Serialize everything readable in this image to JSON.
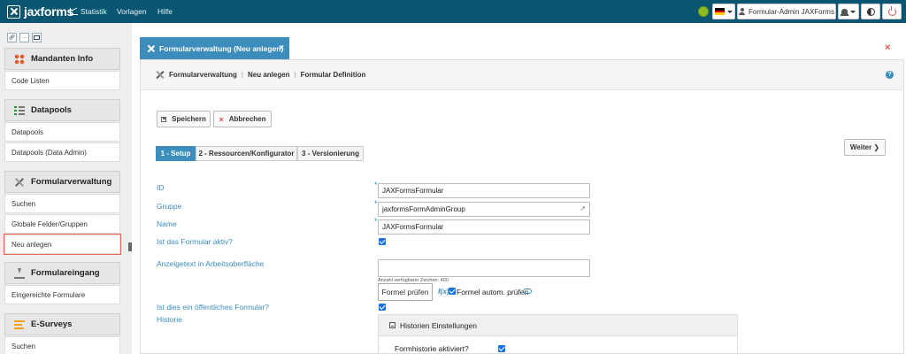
{
  "topbar": {
    "logo_text": "jaxforms",
    "nav": {
      "statistik": "Statistik",
      "vorlagen": "Vorlagen",
      "hilfe": "Hilfe"
    },
    "user_label": "Formular-Admin JAXForms",
    "colors": {
      "bar": "#0a5672",
      "status": "#8fbd1f"
    }
  },
  "sidebar": {
    "tools": [
      "link-icon",
      "ellipsis-icon",
      "folder-icon"
    ],
    "ellipsis": "···",
    "sections": {
      "mandanten": {
        "title": "Mandanten Info",
        "items": [
          "Code Listen"
        ]
      },
      "datapools": {
        "title": "Datapools",
        "items": [
          "Datapools",
          "Datapools (Data Admin)"
        ]
      },
      "formularverwaltung": {
        "title": "Formularverwaltung",
        "items": [
          "Suchen",
          "Globale Felder/Gruppen",
          "Neu anlegen"
        ]
      },
      "formulareingang": {
        "title": "Formulareingang",
        "items": [
          "Eingereichte Formulare"
        ]
      },
      "esurveys": {
        "title": "E-Surveys",
        "items": [
          "Suchen"
        ]
      }
    }
  },
  "tab": {
    "label": "Formularverwaltung (Neu anlegen)",
    "close": "×"
  },
  "close_main": "×",
  "breadcrumb": [
    "Formularverwaltung",
    "Neu anlegen",
    "Formular Definition"
  ],
  "breadcrumb_sep": "|",
  "help": "?",
  "actions": {
    "save": "Speichern",
    "cancel": "Abbrechen",
    "cancel_glyph": "×",
    "next": "Weiter ❯"
  },
  "wizard_tabs": [
    "1 - Setup",
    "2 - Ressourcen/Konfigurator",
    "3 - Versionierung"
  ],
  "form": {
    "required_mark": "*",
    "id": {
      "label": "ID",
      "value": "JAXFormsFormular"
    },
    "gruppe": {
      "label": "Gruppe",
      "value": "jaxformsFormAdminGroup",
      "icon_glyph": "↗"
    },
    "name": {
      "label": "Name",
      "value": "JAXFormsFormular"
    },
    "aktiv": {
      "label": "Ist das Formular aktiv?",
      "checked": true
    },
    "anzeigetext": {
      "label": "Anzeigetext in Arbeitsoberfläche",
      "hint": "Anzahl verfügbarer Zeichen: 400"
    },
    "formel_button": "Formel prüfen",
    "fx": "f(x)",
    "auto_check_label": "Formel autom. prüfen",
    "oeffentlich": {
      "label": "Ist dies ein öffentliches Formular?",
      "checked": true
    },
    "historie": {
      "label": "Historie",
      "panel_title": "Historien Einstellungen",
      "formhistorie_label": "Formhistorie aktiviert?",
      "formhistorie_checked": true
    }
  }
}
